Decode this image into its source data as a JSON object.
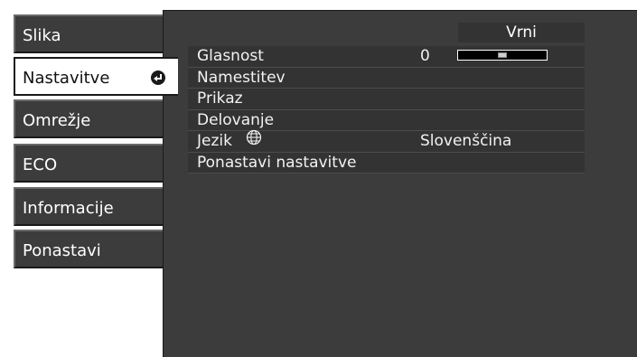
{
  "menu": {
    "items": [
      {
        "label": "Slika"
      },
      {
        "label": "Nastavitve",
        "active": true
      },
      {
        "label": "Omrežje"
      },
      {
        "label": "ECO"
      },
      {
        "label": "Informacije"
      },
      {
        "label": "Ponastavi"
      }
    ],
    "enter_icon": "enter-return-icon"
  },
  "panel": {
    "back_label": "Vrni",
    "rows": [
      {
        "label": "Glasnost",
        "value": "0",
        "control": "volume-slider",
        "slider_level": 0.5
      },
      {
        "label": "Namestitev"
      },
      {
        "label": "Prikaz"
      },
      {
        "label": "Delovanje"
      },
      {
        "label": "Jezik",
        "icon": "globe-icon",
        "value": "Slovenščina"
      },
      {
        "label": "Ponastavi nastavitve"
      }
    ]
  },
  "colors": {
    "panel_bg": "#3c3c3c",
    "row_bg": "#333333",
    "active_tab_bg": "#ffffff"
  }
}
